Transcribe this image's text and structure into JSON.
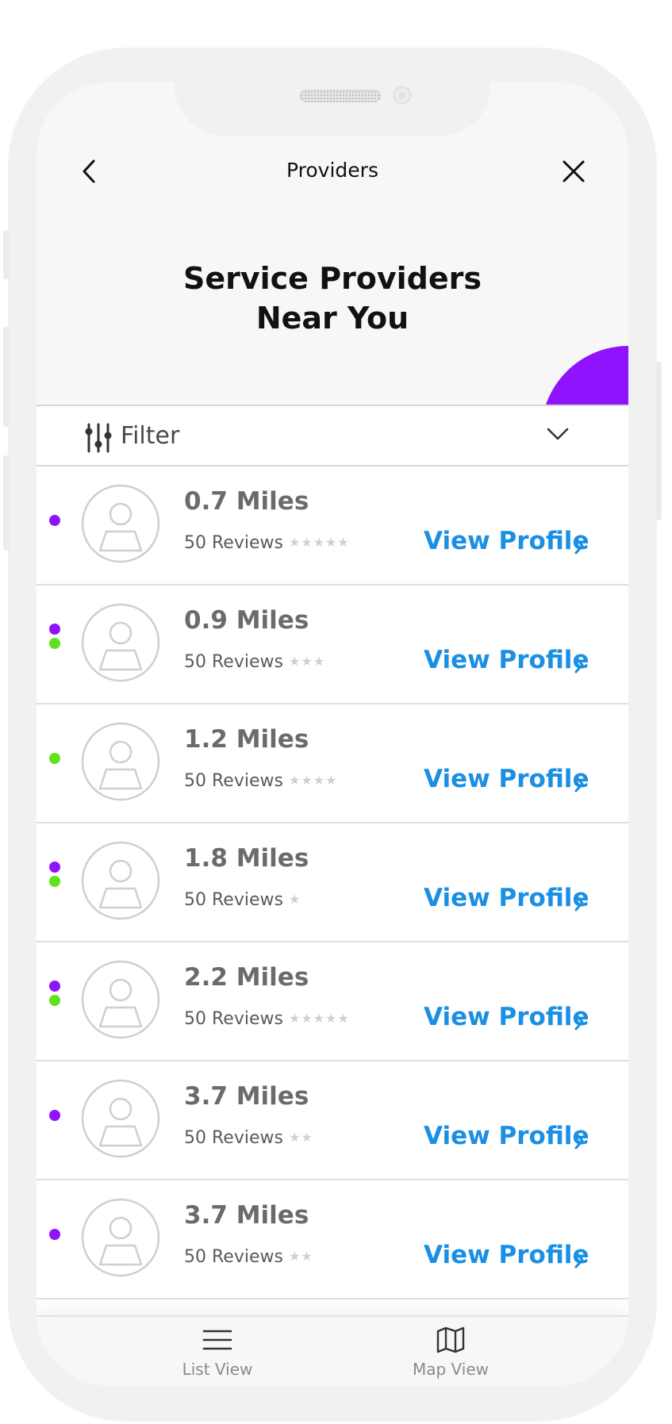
{
  "header": {
    "title": "Providers"
  },
  "hero": {
    "line1": "Service Providers",
    "line2": "Near You"
  },
  "filter": {
    "label": "Filter"
  },
  "providers": [
    {
      "distance": "0.7 Miles",
      "reviews": "50 Reviews",
      "stars": "★★★★★",
      "cta": "View Profile",
      "indicators": [
        "purple"
      ]
    },
    {
      "distance": "0.9 Miles",
      "reviews": "50 Reviews",
      "stars": "★★★",
      "cta": "View Profile",
      "indicators": [
        "purple",
        "green"
      ]
    },
    {
      "distance": "1.2 Miles",
      "reviews": "50 Reviews",
      "stars": "★★★★",
      "cta": "View Profile",
      "indicators": [
        "green"
      ]
    },
    {
      "distance": "1.8 Miles",
      "reviews": "50 Reviews",
      "stars": "★",
      "cta": "View Profile",
      "indicators": [
        "purple",
        "green"
      ]
    },
    {
      "distance": "2.2 Miles",
      "reviews": "50 Reviews",
      "stars": "★★★★★",
      "cta": "View Profile",
      "indicators": [
        "purple",
        "green"
      ]
    },
    {
      "distance": "3.7 Miles",
      "reviews": "50 Reviews",
      "stars": "★★",
      "cta": "View Profile",
      "indicators": [
        "purple"
      ]
    },
    {
      "distance": "3.7 Miles",
      "reviews": "50 Reviews",
      "stars": "★★",
      "cta": "View Profile",
      "indicators": [
        "purple"
      ]
    }
  ],
  "tabs": {
    "list": "List View",
    "map": "Map View"
  },
  "colors": {
    "accent": "#9013fe",
    "link": "#1a8fe3",
    "status_green": "#5fe21b"
  },
  "icons": {
    "back": "chevron-left-icon",
    "close": "close-icon",
    "filter": "sliders-icon",
    "dropdown": "chevron-down-icon",
    "avatar": "user-avatar-icon",
    "list": "hamburger-icon",
    "map": "map-icon"
  }
}
